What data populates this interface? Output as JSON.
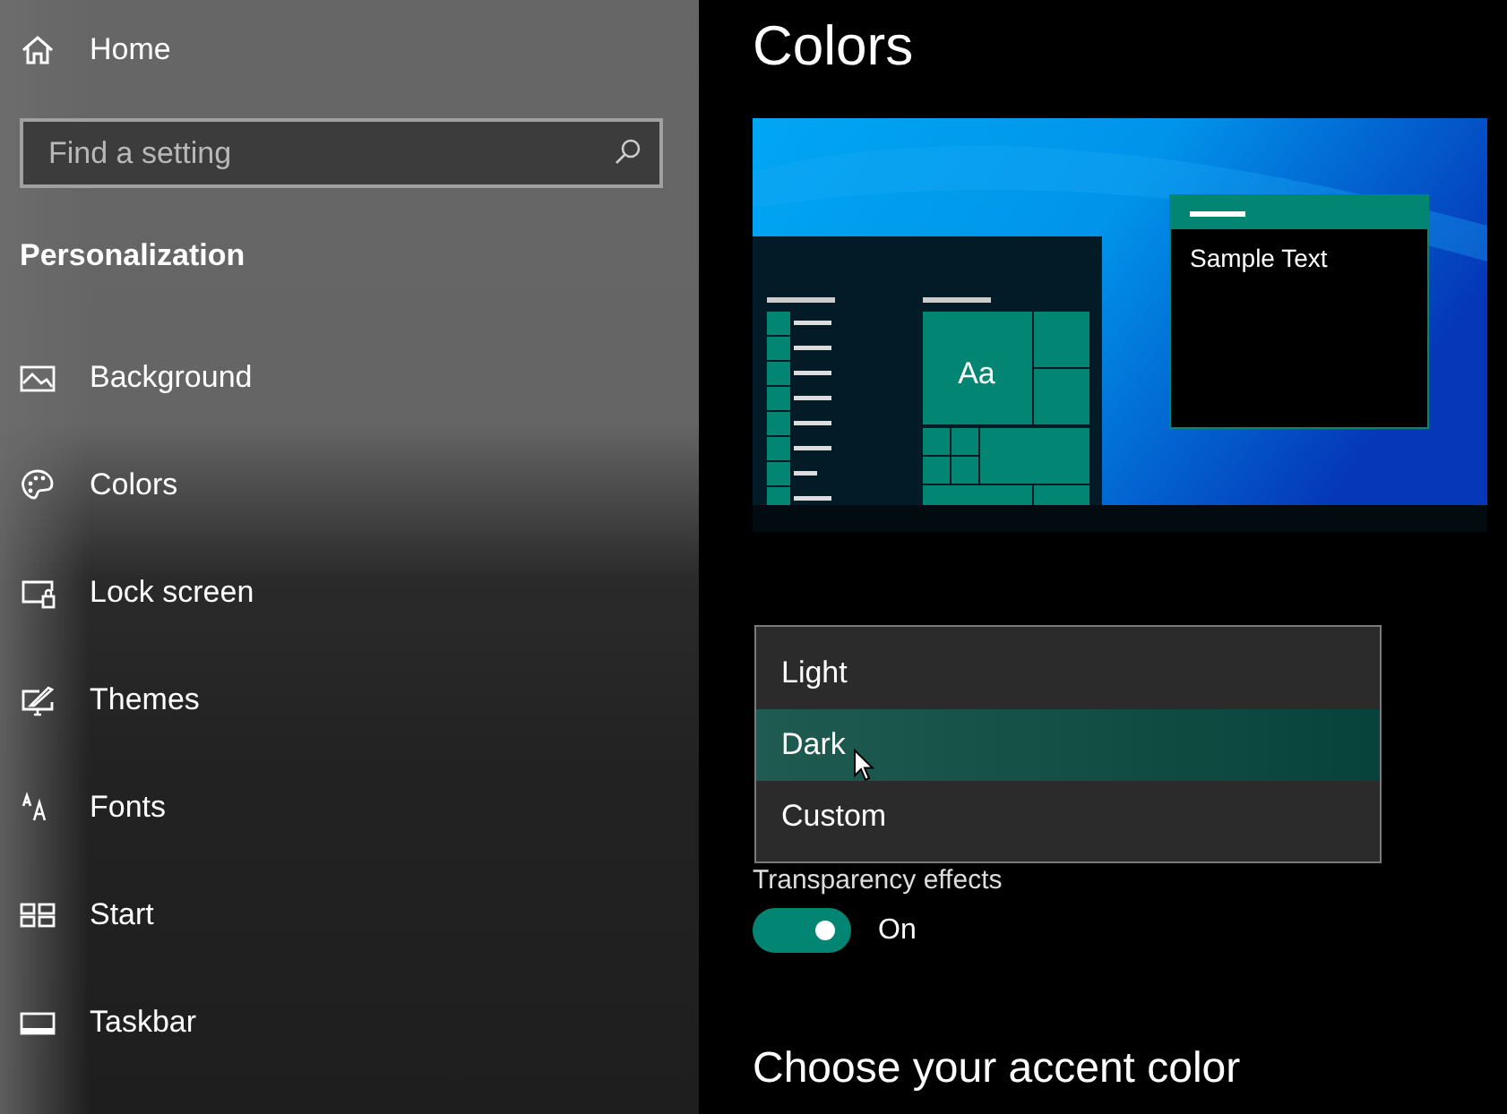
{
  "sidebar": {
    "home": "Home",
    "search": {
      "placeholder": "Find a setting"
    },
    "section": "Personalization",
    "items": [
      {
        "label": "Background"
      },
      {
        "label": "Colors"
      },
      {
        "label": "Lock screen"
      },
      {
        "label": "Themes"
      },
      {
        "label": "Fonts"
      },
      {
        "label": "Start"
      },
      {
        "label": "Taskbar"
      }
    ]
  },
  "page": {
    "title": "Colors",
    "preview": {
      "tile_text": "Aa",
      "sample_text": "Sample Text"
    },
    "mode_options": [
      {
        "label": "Light",
        "selected": false
      },
      {
        "label": "Dark",
        "selected": true
      },
      {
        "label": "Custom",
        "selected": false
      }
    ],
    "transparency": {
      "label": "Transparency effects",
      "on": true,
      "state_text": "On"
    },
    "accent_heading": "Choose your accent color"
  }
}
